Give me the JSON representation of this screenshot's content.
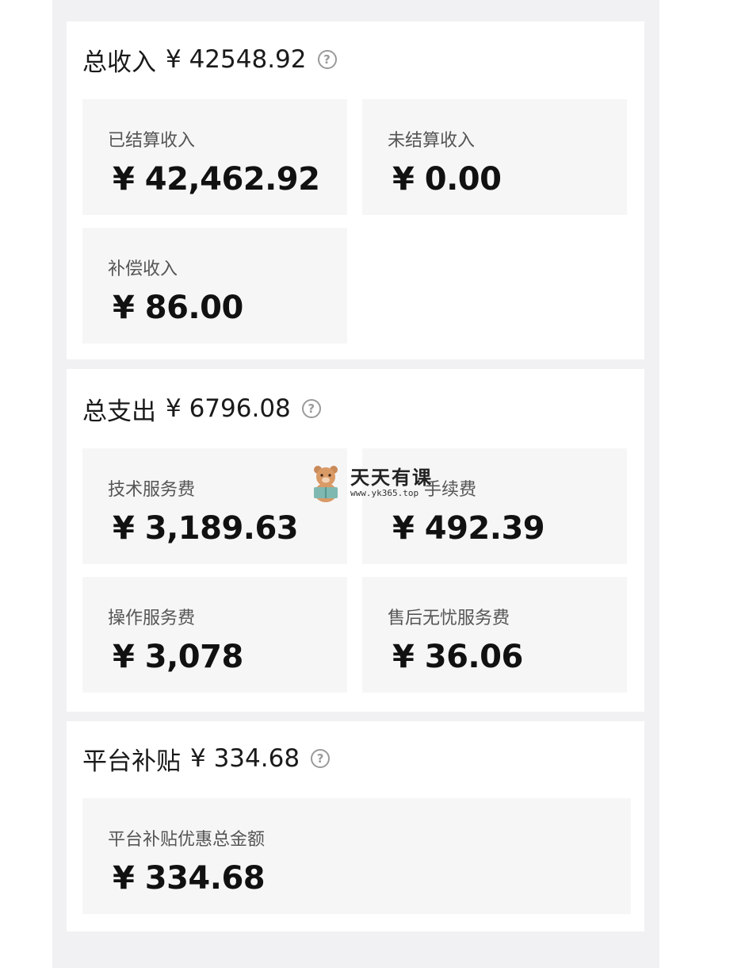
{
  "income": {
    "title": "总收入",
    "amount": "¥ 42548.92",
    "settled_label": "已结算收入",
    "settled_value": "¥ 42,462.92",
    "unsettled_label": "未结算收入",
    "unsettled_value": "¥ 0.00",
    "compensation_label": "补偿收入",
    "compensation_value": "¥ 86.00"
  },
  "expense": {
    "title": "总支出",
    "amount": "¥ 6796.08",
    "tech_fee_label": "技术服务费",
    "tech_fee_value": "¥ 3,189.63",
    "handling_fee_label": "手续费",
    "handling_fee_value": "¥ 492.39",
    "operation_fee_label": "操作服务费",
    "operation_fee_value": "¥ 3,078",
    "aftersale_fee_label": "售后无忧服务费",
    "aftersale_fee_value": "¥ 36.06"
  },
  "subsidy": {
    "title": "平台补贴",
    "amount": "¥ 334.68",
    "discount_total_label": "平台补贴优惠总金额",
    "discount_total_value": "¥ 334.68"
  },
  "watermark": {
    "main": "天天有课",
    "sub": "www.yk365.top"
  },
  "icons": {
    "help": "help-circle-icon",
    "bear": "bear-logo-icon"
  },
  "colors": {
    "background": "#f1f1f3",
    "card": "#ffffff",
    "tile": "#f6f6f7",
    "text": "#1a1a1a",
    "label": "#555555"
  }
}
